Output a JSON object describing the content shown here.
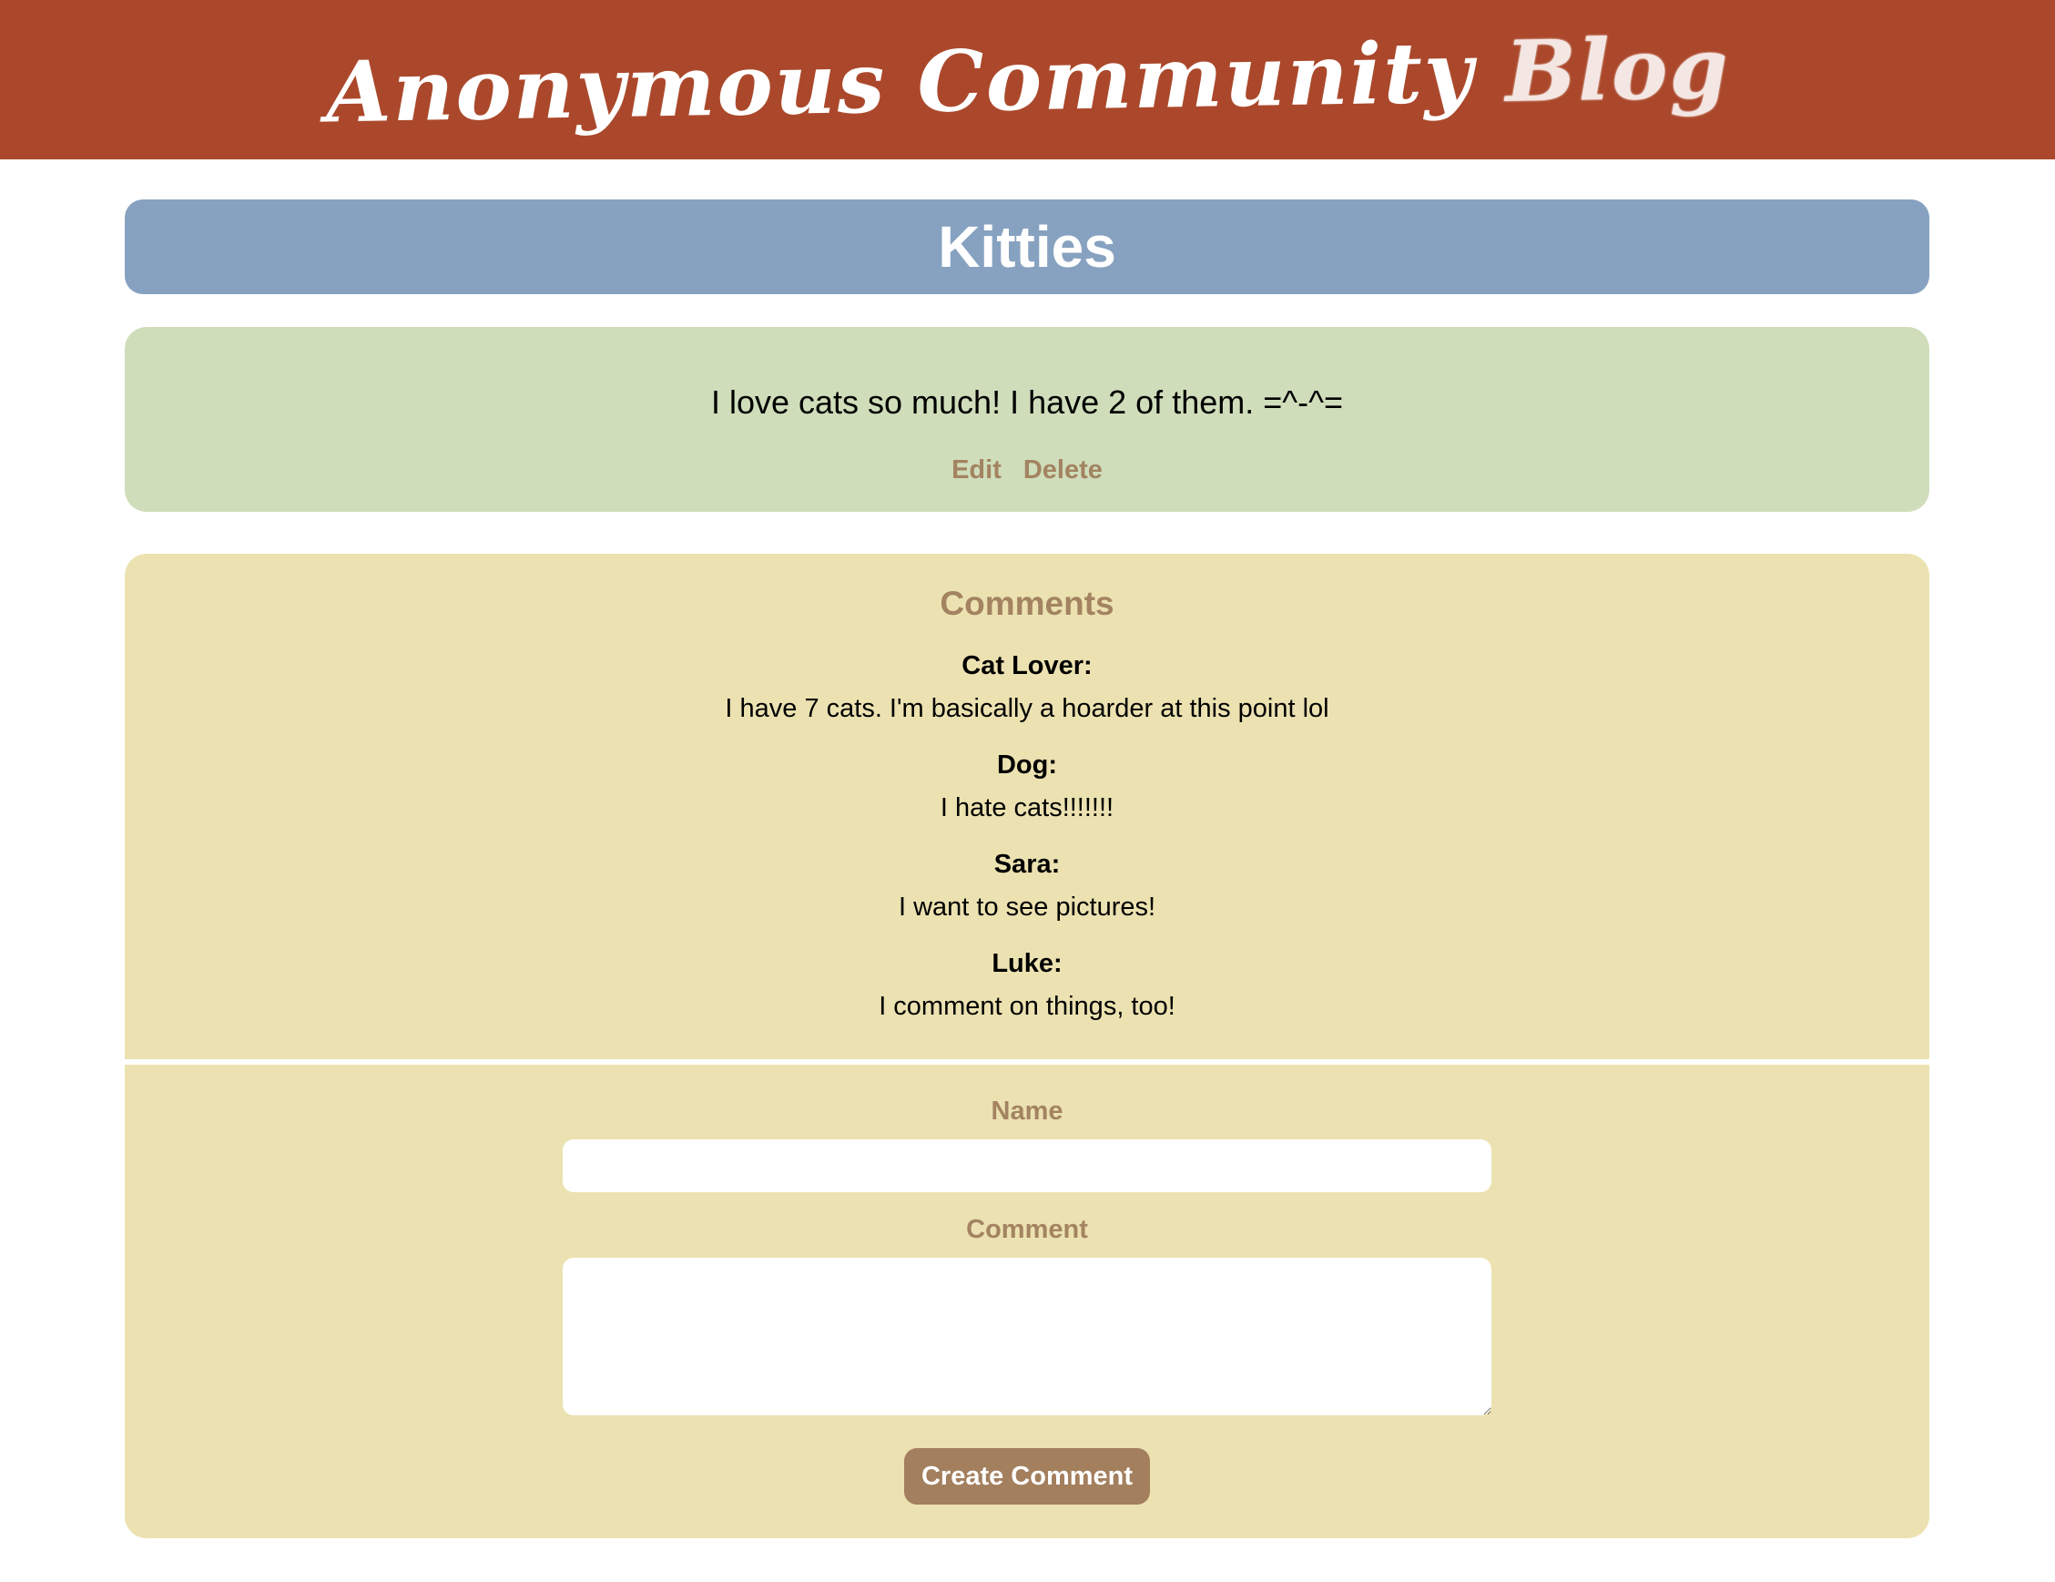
{
  "header": {
    "title_main": "Anonymous Community",
    "title_blog": "Blog"
  },
  "post": {
    "title": "Kitties",
    "content": "I love cats so much! I have 2 of them. =^-^=",
    "actions": {
      "edit_label": "Edit",
      "delete_label": "Delete"
    }
  },
  "comments": {
    "heading": "Comments",
    "items": [
      {
        "author": "Cat Lover:",
        "text": "I have 7 cats. I'm basically a hoarder at this point lol"
      },
      {
        "author": "Dog:",
        "text": "I hate cats!!!!!!!"
      },
      {
        "author": "Sara:",
        "text": "I want to see pictures!"
      },
      {
        "author": "Luke:",
        "text": "I comment on things, too!"
      }
    ]
  },
  "form": {
    "name_label": "Name",
    "name_value": "",
    "comment_label": "Comment",
    "comment_value": "",
    "submit_label": "Create Comment"
  },
  "colors": {
    "header_bg": "#ab482b",
    "title_card_bg": "#87a2c0",
    "post_card_bg": "#cfddba",
    "comments_card_bg": "#ece2b1",
    "accent_brown": "#a38361"
  }
}
